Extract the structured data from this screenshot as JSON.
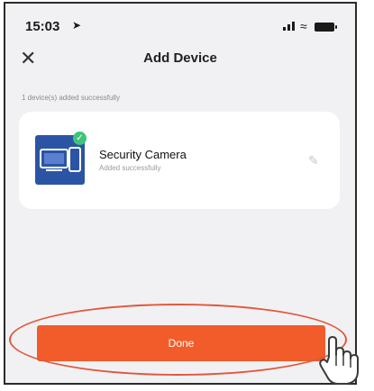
{
  "status_bar": {
    "time": "15:03",
    "location_arrow": "location-arrow-icon"
  },
  "header": {
    "title": "Add Device",
    "close_icon": "close-icon"
  },
  "subtitle": "1 device(s) added successfully",
  "device": {
    "name": "Security Camera",
    "status": "Added successfully",
    "edit_icon": "pencil-icon"
  },
  "done_button": {
    "label": "Done"
  },
  "colors": {
    "accent": "#f25c2a",
    "highlight": "#e2573b",
    "success": "#3ec47b",
    "device_bg": "#2c54a4"
  }
}
